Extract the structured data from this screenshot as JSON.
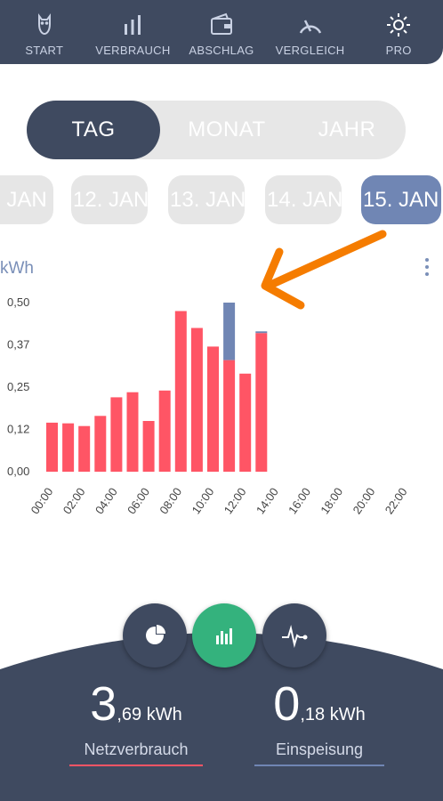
{
  "nav": {
    "items": [
      {
        "label": "START",
        "icon": "owl-icon"
      },
      {
        "label": "VERBRAUCH",
        "icon": "bars-icon"
      },
      {
        "label": "ABSCHLAG",
        "icon": "wallet-icon"
      },
      {
        "label": "VERGLEICH",
        "icon": "gauge-icon"
      },
      {
        "label": "PRO",
        "icon": "sun-icon"
      }
    ]
  },
  "segments": {
    "tag": "TAG",
    "monat": "MONAT",
    "jahr": "JAHR",
    "selected": "TAG"
  },
  "dates": {
    "items": [
      ". JAN",
      "12. JAN",
      "13. JAN",
      "14. JAN",
      "15. JAN"
    ],
    "selected": "15. JAN"
  },
  "chart_unit": "kWh",
  "colors": {
    "nav_bg": "#3f4a60",
    "consumption": "#ff5565",
    "feed_in": "#7086b4",
    "active_green": "#34b27d",
    "annotation": "#f57c00"
  },
  "chart_data": {
    "type": "bar",
    "ylabel": "kWh",
    "ylim": [
      0,
      0.5
    ],
    "yticks": [
      "0,00",
      "0,12",
      "0,25",
      "0,37",
      "0,50"
    ],
    "xtick_labels": [
      "00:00",
      "02:00",
      "04:00",
      "06:00",
      "08:00",
      "10:00",
      "12:00",
      "14:00",
      "16:00",
      "18:00",
      "20:00",
      "22:00"
    ],
    "series": [
      {
        "values": [
          0.145,
          0.143,
          0.135,
          0.165,
          0.22,
          0.235,
          0.15,
          0.24,
          0.475,
          0.425,
          0.37,
          0.33,
          0.29,
          0.41
        ]
      },
      {
        "values": [
          0,
          0,
          0,
          0,
          0,
          0,
          0,
          0,
          0,
          0,
          0,
          0.17,
          0,
          0.005
        ]
      }
    ]
  },
  "stats": {
    "consumption": {
      "int": "3",
      "rest": ",69 kWh",
      "label": "Netzverbrauch"
    },
    "feedin": {
      "int": "0",
      "rest": ",18 kWh",
      "label": "Einspeisung"
    }
  },
  "fabs": [
    {
      "icon": "pie-chart-icon"
    },
    {
      "icon": "bar-chart-icon"
    },
    {
      "icon": "pulse-icon"
    }
  ]
}
